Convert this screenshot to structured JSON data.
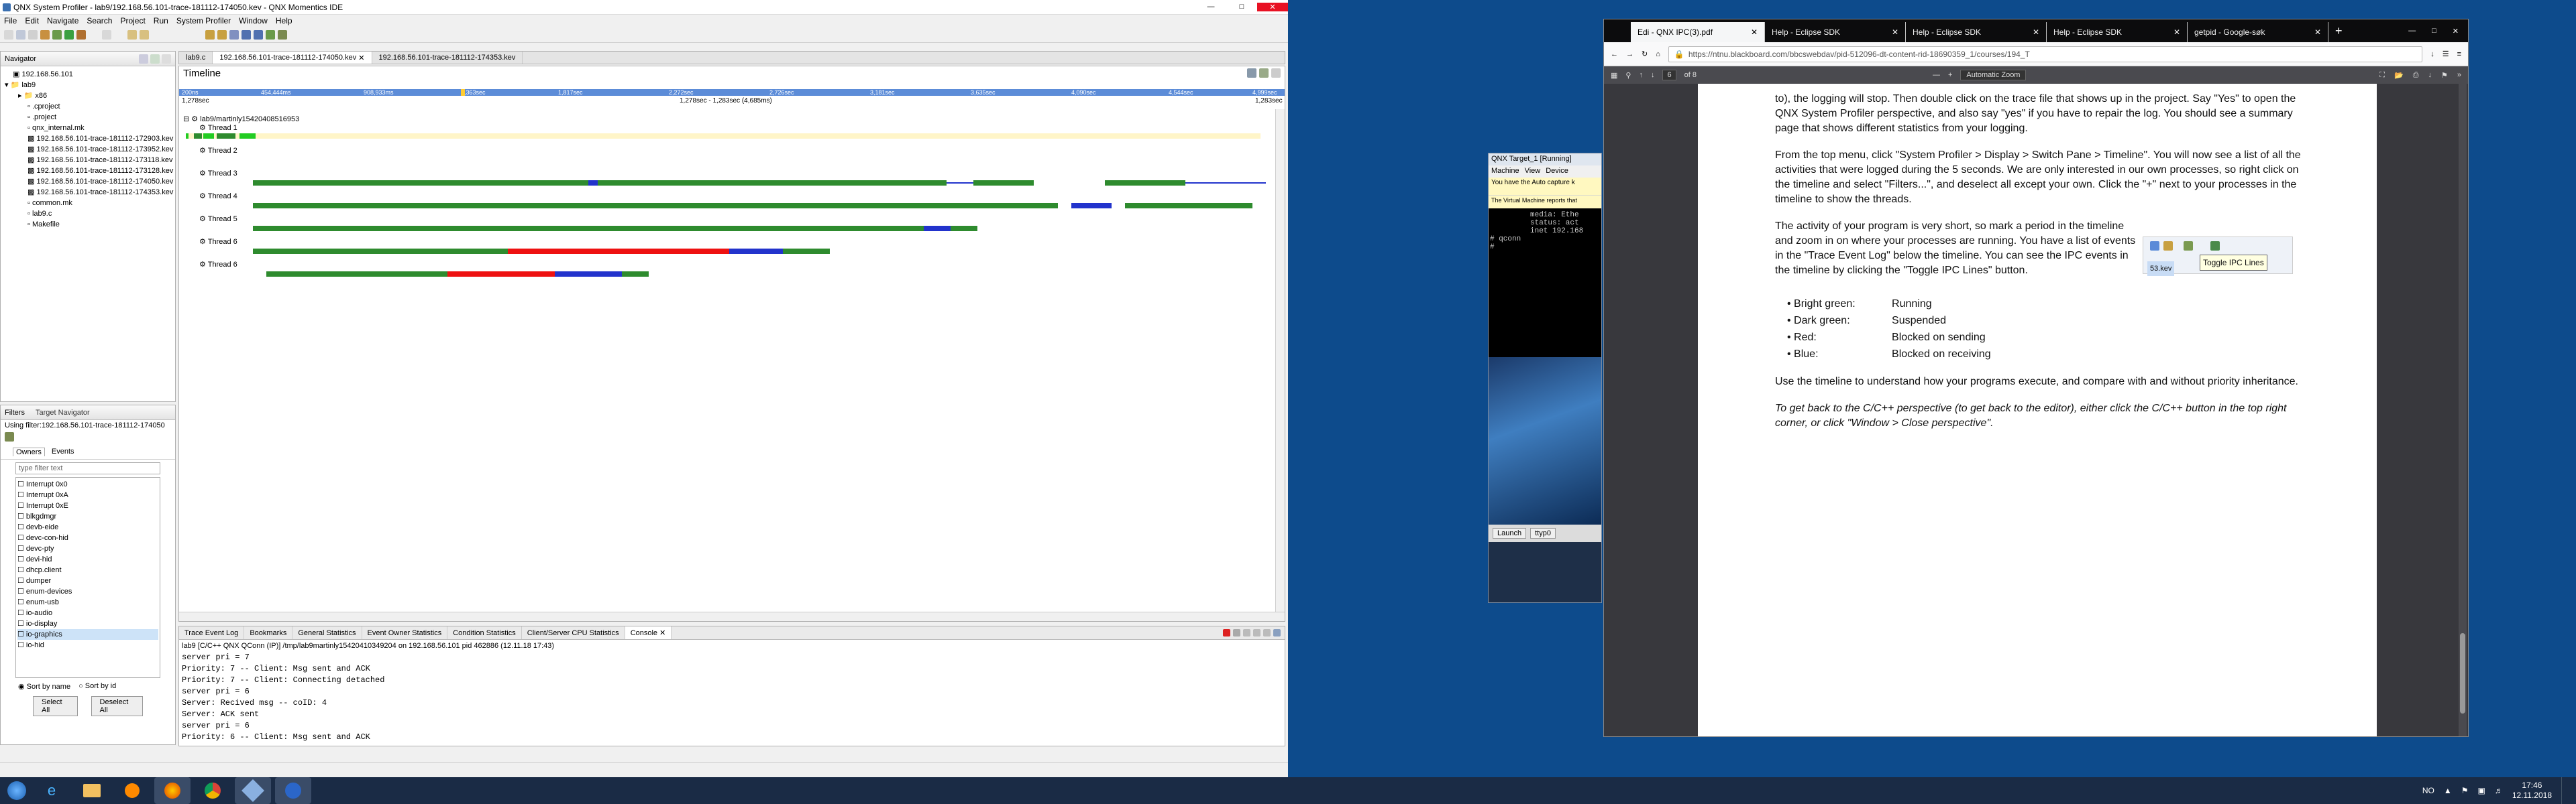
{
  "ide": {
    "title": "QNX System Profiler - lab9/192.168.56.101-trace-181112-174050.kev - QNX Momentics IDE",
    "menu": [
      "File",
      "Edit",
      "Navigate",
      "Search",
      "Project",
      "Run",
      "System Profiler",
      "Window",
      "Help"
    ],
    "editor_tabs": [
      "lab9.c",
      "192.168.56.101-trace-181112-174050.kev",
      "192.168.56.101-trace-181112-174353.kev"
    ],
    "navigator": {
      "title": "Navigator",
      "items": [
        "192.168.56.101",
        "lab9",
        "x86",
        ".cproject",
        ".project",
        "qnx_internal.mk",
        "192.168.56.101-trace-181112-172903.kev",
        "192.168.56.101-trace-181112-173952.kev",
        "192.168.56.101-trace-181112-173118.kev",
        "192.168.56.101-trace-181112-173128.kev",
        "192.168.56.101-trace-181112-174050.kev",
        "192.168.56.101-trace-181112-174353.kev",
        "common.mk",
        "lab9.c",
        "Makefile"
      ]
    },
    "filters": {
      "tab1": "Filters",
      "tab2": "Target Navigator",
      "using": "Using filter:192.168.56.101-trace-181112-174050",
      "subtab1": "Owners",
      "subtab2": "Events",
      "filter_placeholder": "type filter text",
      "owners": [
        "Interrupt 0x0",
        "Interrupt 0xA",
        "Interrupt 0xE",
        "blkgdmgr",
        "devb-eide",
        "devc-con-hid",
        "devc-pty",
        "devi-hid",
        "dhcp.client",
        "dumper",
        "enum-devices",
        "enum-usb",
        "io-audio",
        "io-display",
        "io-graphics",
        "io-hid"
      ],
      "sort_name": "Sort by name",
      "sort_id": "Sort by id",
      "select_all": "Select All",
      "deselect_all": "Deselect All"
    },
    "timeline": {
      "title": "Timeline",
      "ruler": [
        "200ns",
        "454,444ms",
        "908,933ms",
        "1,363sec",
        "1,817sec",
        "2,272sec",
        "2,726sec",
        "3,181sec",
        "3,635sec",
        "4,090sec",
        "4,544sec",
        "4,999sec"
      ],
      "range_start": "1,278sec",
      "range_mid": "1,278sec - 1,283sec (4,685ms)",
      "range_end": "1,283sec",
      "process": "lab9/martinly15420408516953",
      "threads": [
        "Thread 1",
        "Thread 2",
        "Thread 3",
        "Thread 4",
        "Thread 5",
        "Thread 6"
      ]
    },
    "bottom_tabs": [
      "Trace Event Log",
      "Bookmarks",
      "General Statistics",
      "Event Owner Statistics",
      "Condition Statistics",
      "Client/Server CPU Statistics",
      "Console"
    ],
    "console_header": "lab9 [C/C++ QNX QConn (IP)] /tmp/lab9martinly15420410349204 on 192.168.56.101 pid 462886 (12.11.18 17:43)",
    "console_lines": [
      "server pri = 7",
      "Priority: 7 -- Client: Msg sent and ACK",
      "Priority: 7 -- Client: Connecting detached",
      "server pri = 6",
      "Server: Recived msg -- coID: 4",
      "Server: ACK sent",
      "server pri = 6",
      "Priority: 6 -- Client: Msg sent and ACK"
    ]
  },
  "vm": {
    "title": "QNX Target_1 [Running]",
    "menu": [
      "Machine",
      "View",
      "Device"
    ],
    "notice": "You have the Auto capture k",
    "notice2": "The Virtual Machine reports that",
    "lines": [
      "media: Ethe",
      "status: act",
      "inet 192.168"
    ],
    "prompt": "# qconn",
    "prompt2": "#",
    "launch": "Launch",
    "ttyp": "ttyp0"
  },
  "firefox": {
    "tabs": [
      "Edi - QNX IPC(3).pdf",
      "Help - Eclipse SDK",
      "Help - Eclipse SDK",
      "Help - Eclipse SDK",
      "getpid - Google-søk"
    ],
    "url": "https://ntnu.blackboard.com/bbcswebdav/pid-512096-dt-content-rid-18690359_1/courses/194_T",
    "page": "6",
    "of": "of 8",
    "zoom": "Automatic Zoom",
    "p1": "to), the logging will stop. Then double click on the trace file that shows up in the project. Say \"Yes\" to open the QNX System Profiler perspective, and also say \"yes\" if you have to repair the log. You should see a summary page that shows different statistics from your logging.",
    "p2": "From the top menu, click \"System Profiler > Display > Switch Pane > Timeline\". You will now see a list of all the activities that were logged during the 5 seconds. We are only interested in our own processes, so right click on the timeline and select \"Filters...\", and deselect all except your own. Click the \"+\" next to your processes in the timeline to show the threads.",
    "p3": "The activity of your program is very short, so mark a period in the timeline and zoom in on where your processes are running. You have a list of events in the \"Trace Event Log\" below the timeline. You can see the IPC events in the timeline by clicking the \"Toggle IPC Lines\" button.",
    "tooltip": "Toggle IPC Lines",
    "snippet_file": "53.kev",
    "legend": [
      {
        "k": "Bright green:",
        "v": "Running"
      },
      {
        "k": "Dark green:",
        "v": "Suspended"
      },
      {
        "k": "Red:",
        "v": "Blocked on sending"
      },
      {
        "k": "Blue:",
        "v": "Blocked on receiving"
      }
    ],
    "p4": "Use the timeline to understand how your programs execute, and compare with and without priority inheritance.",
    "p5": "To get back to the C/C++ perspective (to get back to the editor), either click the C/C++ button in the top right corner, or click \"Window > Close perspective\"."
  },
  "taskbar": {
    "lang": "NO",
    "time": "17:46",
    "date": "12.11.2018"
  },
  "colors": {
    "running": "#22cc22",
    "suspended": "#2e8b2e",
    "send_blocked": "#ee1111",
    "receive_blocked": "#2233cc"
  }
}
